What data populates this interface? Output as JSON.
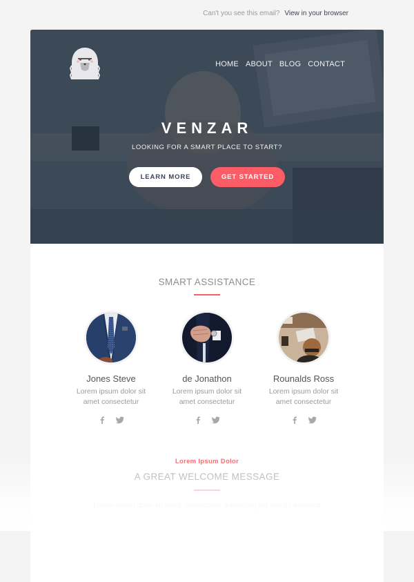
{
  "preheader": {
    "text": "Can't you see this email?",
    "link": "View in your browser"
  },
  "hero": {
    "logo": "sheepdog-logo",
    "nav": [
      "HOME",
      "ABOUT",
      "BLOG",
      "CONTACT"
    ],
    "brand": "VENZAR",
    "tagline": "LOOKING FOR A SMART PLACE TO START?",
    "buttons": {
      "learn_more": "LEARN MORE",
      "get_started": "GET STARTED"
    }
  },
  "team_section": {
    "title": "SMART ASSISTANCE",
    "members": [
      {
        "name": "Jones Steve",
        "desc_line1": "Lorem ipsum dolor sit",
        "desc_line2": "amet consectetur",
        "photo": "man-in-blue-suit-tie"
      },
      {
        "name": "de Jonathon",
        "desc_line1": "Lorem ipsum dolor sit",
        "desc_line2": "amet consectetur",
        "photo": "hands-adjusting-cufflink"
      },
      {
        "name": "Rounalds Ross",
        "desc_line1": "Lorem ipsum dolor sit",
        "desc_line2": "amet consectetur",
        "photo": "person-at-desk"
      }
    ],
    "social_icons": [
      "facebook-icon",
      "twitter-icon"
    ]
  },
  "welcome_section": {
    "kicker": "Lorem Ipsum Dolor",
    "title": "A GREAT WELCOME MESSAGE",
    "body": "Lorem ipsum dolor sit amet, consectetur adipiscing elit sed do eiusmod"
  },
  "colors": {
    "accent": "#fc5c65",
    "hero_overlay": "#3e4a59",
    "page_bg": "#f4f4f4",
    "text_dark": "#3c4454"
  }
}
